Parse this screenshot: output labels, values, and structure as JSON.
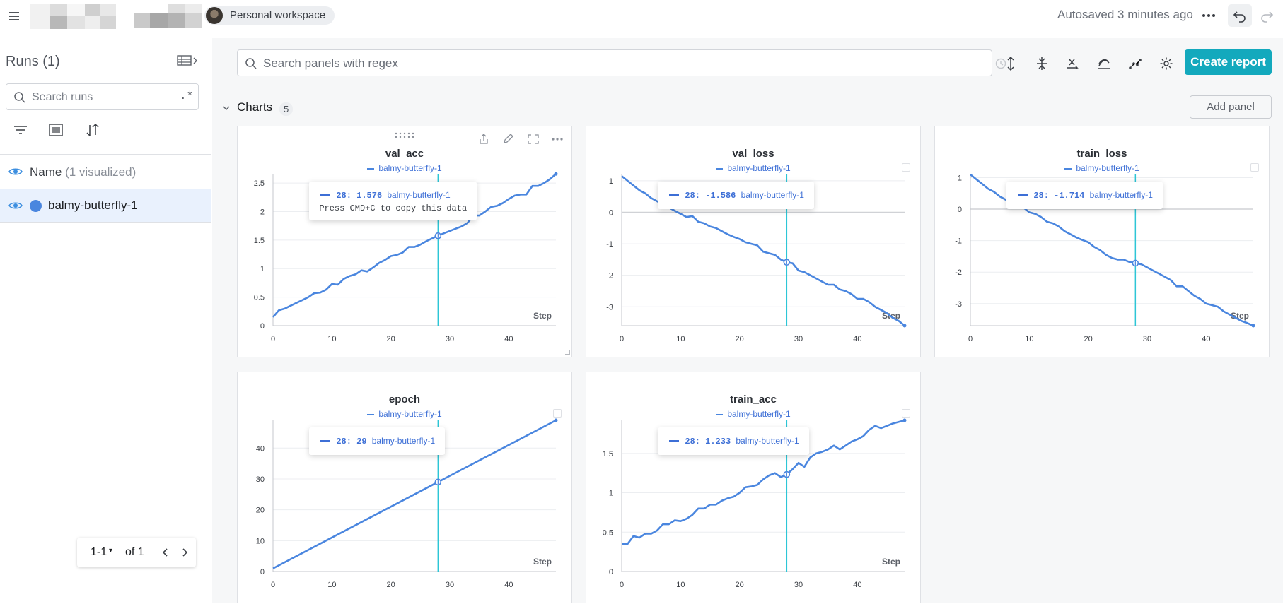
{
  "header": {
    "workspace": "Personal workspace",
    "autosave": "Autosaved 3 minutes ago"
  },
  "sidebar": {
    "title": "Runs (1)",
    "search_placeholder": "Search runs",
    "regex_label": ".*",
    "name_column": "Name",
    "name_sub": "(1 visualized)",
    "runs": [
      {
        "name": "balmy-butterfly-1",
        "color": "#4a86df"
      }
    ],
    "pager": {
      "range": "1-1",
      "of": "of 1"
    }
  },
  "main": {
    "search_placeholder": "Search panels with regex",
    "create_report": "Create report",
    "section": {
      "title": "Charts",
      "count": "5",
      "add_panel": "Add panel"
    }
  },
  "colors": {
    "accent": "#13a9bd",
    "series": "#4a86df",
    "cursor": "#2dc6d6"
  },
  "chart_data": [
    {
      "type": "line",
      "title": "val_acc",
      "xlabel": "Step",
      "legend": "balmy-butterfly-1",
      "xlim": [
        0,
        48
      ],
      "ylim": [
        0,
        2.65
      ],
      "xticks": [
        "0",
        "10",
        "20",
        "30",
        "40"
      ],
      "yticks": [
        "0",
        "0.5",
        "1",
        "1.5",
        "2",
        "2.5"
      ],
      "series": [
        {
          "name": "balmy-butterfly-1",
          "x": [
            0,
            1,
            2,
            3,
            4,
            5,
            6,
            7,
            8,
            9,
            10,
            11,
            12,
            13,
            14,
            15,
            16,
            17,
            18,
            19,
            20,
            21,
            22,
            23,
            24,
            25,
            26,
            27,
            28,
            29,
            30,
            31,
            32,
            33,
            34,
            35,
            36,
            37,
            38,
            39,
            40,
            41,
            42,
            43,
            44,
            45,
            46,
            47,
            48
          ],
          "y": [
            0.15,
            0.27,
            0.3,
            0.35,
            0.4,
            0.45,
            0.5,
            0.57,
            0.58,
            0.63,
            0.73,
            0.72,
            0.82,
            0.87,
            0.9,
            0.97,
            0.95,
            1.02,
            1.1,
            1.15,
            1.22,
            1.24,
            1.28,
            1.38,
            1.38,
            1.42,
            1.48,
            1.53,
            1.576,
            1.62,
            1.66,
            1.7,
            1.74,
            1.8,
            1.93,
            1.93,
            2.0,
            2.08,
            2.1,
            2.15,
            2.22,
            2.28,
            2.3,
            2.3,
            2.45,
            2.45,
            2.5,
            2.57,
            2.66
          ]
        }
      ],
      "cursor": {
        "x": 28,
        "value": "1.576",
        "label": "28:"
      },
      "tooltip_hint": "Press CMD+C to copy this data"
    },
    {
      "type": "line",
      "title": "val_loss",
      "xlabel": "Step",
      "legend": "balmy-butterfly-1",
      "xlim": [
        0,
        48
      ],
      "ylim": [
        -3.6,
        1.2
      ],
      "xticks": [
        "0",
        "10",
        "20",
        "30",
        "40"
      ],
      "yticks": [
        "1",
        "0",
        "-1",
        "-2",
        "-3"
      ],
      "series": [
        {
          "name": "balmy-butterfly-1",
          "x": [
            0,
            1,
            2,
            3,
            4,
            5,
            6,
            7,
            8,
            9,
            10,
            11,
            12,
            13,
            14,
            15,
            16,
            17,
            18,
            19,
            20,
            21,
            22,
            23,
            24,
            25,
            26,
            27,
            28,
            29,
            30,
            31,
            32,
            33,
            34,
            35,
            36,
            37,
            38,
            39,
            40,
            41,
            42,
            43,
            44,
            45,
            46,
            47,
            48
          ],
          "y": [
            1.15,
            1.0,
            0.85,
            0.7,
            0.6,
            0.45,
            0.35,
            0.25,
            0.15,
            0.05,
            -0.05,
            -0.15,
            -0.12,
            -0.3,
            -0.35,
            -0.45,
            -0.5,
            -0.6,
            -0.7,
            -0.78,
            -0.85,
            -0.95,
            -1.0,
            -1.05,
            -1.25,
            -1.3,
            -1.35,
            -1.5,
            -1.586,
            -1.62,
            -1.85,
            -1.9,
            -2.0,
            -2.1,
            -2.2,
            -2.3,
            -2.3,
            -2.45,
            -2.5,
            -2.6,
            -2.75,
            -2.75,
            -2.85,
            -3.0,
            -3.1,
            -3.2,
            -3.35,
            -3.45,
            -3.6
          ]
        }
      ],
      "cursor": {
        "x": 28,
        "value": "-1.586",
        "label": "28:"
      }
    },
    {
      "type": "line",
      "title": "train_loss",
      "xlabel": "Step",
      "legend": "balmy-butterfly-1",
      "xlim": [
        0,
        48
      ],
      "ylim": [
        -3.7,
        1.1
      ],
      "xticks": [
        "0",
        "10",
        "20",
        "30",
        "40"
      ],
      "yticks": [
        "1",
        "0",
        "-1",
        "-2",
        "-3"
      ],
      "series": [
        {
          "name": "balmy-butterfly-1",
          "x": [
            0,
            1,
            2,
            3,
            4,
            5,
            6,
            7,
            8,
            9,
            10,
            11,
            12,
            13,
            14,
            15,
            16,
            17,
            18,
            19,
            20,
            21,
            22,
            23,
            24,
            25,
            26,
            27,
            28,
            29,
            30,
            31,
            32,
            33,
            34,
            35,
            36,
            37,
            38,
            39,
            40,
            41,
            42,
            43,
            44,
            45,
            46,
            47,
            48
          ],
          "y": [
            1.1,
            0.95,
            0.8,
            0.65,
            0.55,
            0.4,
            0.3,
            0.2,
            0.1,
            0.05,
            -0.1,
            -0.15,
            -0.25,
            -0.4,
            -0.45,
            -0.55,
            -0.7,
            -0.8,
            -0.9,
            -0.98,
            -1.05,
            -1.2,
            -1.3,
            -1.45,
            -1.55,
            -1.6,
            -1.6,
            -1.68,
            -1.714,
            -1.75,
            -1.85,
            -1.95,
            -2.05,
            -2.15,
            -2.25,
            -2.45,
            -2.45,
            -2.6,
            -2.75,
            -2.85,
            -3.0,
            -3.05,
            -3.1,
            -3.25,
            -3.35,
            -3.45,
            -3.55,
            -3.62,
            -3.7
          ]
        }
      ],
      "cursor": {
        "x": 28,
        "value": "-1.714",
        "label": "28:"
      }
    },
    {
      "type": "line",
      "title": "epoch",
      "xlabel": "Step",
      "legend": "balmy-butterfly-1",
      "xlim": [
        0,
        48
      ],
      "ylim": [
        0,
        49
      ],
      "xticks": [
        "0",
        "10",
        "20",
        "30",
        "40"
      ],
      "yticks": [
        "0",
        "10",
        "20",
        "30",
        "40"
      ],
      "series": [
        {
          "name": "balmy-butterfly-1",
          "x": [
            0,
            28,
            48
          ],
          "y": [
            1,
            29,
            49
          ]
        }
      ],
      "cursor": {
        "x": 28,
        "value": "29",
        "label": "28:"
      }
    },
    {
      "type": "line",
      "title": "train_acc",
      "xlabel": "Step",
      "legend": "balmy-butterfly-1",
      "xlim": [
        0,
        48
      ],
      "ylim": [
        0,
        1.92
      ],
      "xticks": [
        "0",
        "10",
        "20",
        "30",
        "40"
      ],
      "yticks": [
        "0",
        "0.5",
        "1",
        "1.5"
      ],
      "series": [
        {
          "name": "balmy-butterfly-1",
          "x": [
            0,
            1,
            2,
            3,
            4,
            5,
            6,
            7,
            8,
            9,
            10,
            11,
            12,
            13,
            14,
            15,
            16,
            17,
            18,
            19,
            20,
            21,
            22,
            23,
            24,
            25,
            26,
            27,
            28,
            29,
            30,
            31,
            32,
            33,
            34,
            35,
            36,
            37,
            38,
            39,
            40,
            41,
            42,
            43,
            44,
            45,
            46,
            47,
            48
          ],
          "y": [
            0.35,
            0.35,
            0.45,
            0.43,
            0.48,
            0.48,
            0.52,
            0.6,
            0.6,
            0.65,
            0.64,
            0.67,
            0.72,
            0.8,
            0.8,
            0.85,
            0.85,
            0.9,
            0.93,
            0.95,
            1.0,
            1.07,
            1.08,
            1.1,
            1.17,
            1.22,
            1.25,
            1.2,
            1.233,
            1.3,
            1.38,
            1.33,
            1.45,
            1.5,
            1.52,
            1.55,
            1.6,
            1.55,
            1.6,
            1.65,
            1.68,
            1.72,
            1.8,
            1.85,
            1.82,
            1.85,
            1.88,
            1.9,
            1.92
          ]
        }
      ],
      "cursor": {
        "x": 28,
        "value": "1.233",
        "label": "28:"
      }
    }
  ]
}
